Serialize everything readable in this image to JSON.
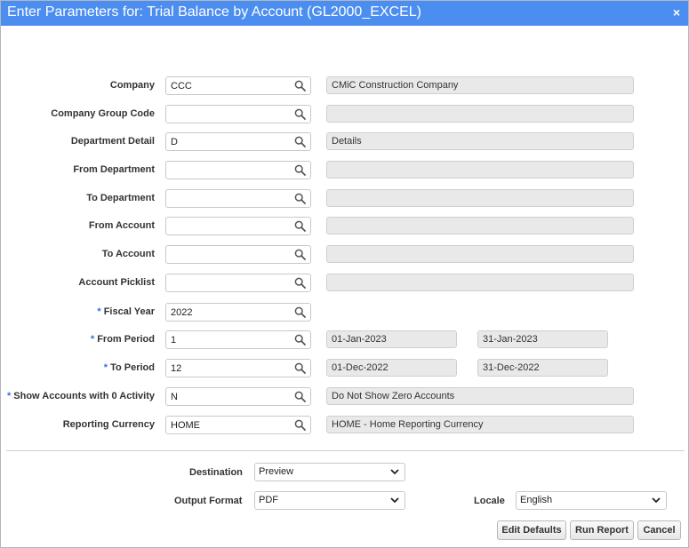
{
  "dialog": {
    "title": "Enter Parameters for: Trial Balance by Account (GL2000_EXCEL)",
    "close_glyph": "×"
  },
  "params": [
    {
      "label": "Company",
      "required": false,
      "value": "CCC",
      "desc": "CMiC Construction Company"
    },
    {
      "label": "Company Group Code",
      "required": false,
      "value": "",
      "desc": ""
    },
    {
      "label": "Department Detail",
      "required": false,
      "value": "D",
      "desc": "Details"
    },
    {
      "label": "From Department",
      "required": false,
      "value": "",
      "desc": ""
    },
    {
      "label": "To Department",
      "required": false,
      "value": "",
      "desc": ""
    },
    {
      "label": "From Account",
      "required": false,
      "value": "",
      "desc": ""
    },
    {
      "label": "To Account",
      "required": false,
      "value": "",
      "desc": ""
    },
    {
      "label": "Account Picklist",
      "required": false,
      "value": "",
      "desc": ""
    },
    {
      "label": "Fiscal Year",
      "required": true,
      "value": "2022"
    },
    {
      "label": "From Period",
      "required": true,
      "value": "1",
      "start": "01-Jan-2023",
      "end": "31-Jan-2023"
    },
    {
      "label": "To Period",
      "required": true,
      "value": "12",
      "start": "01-Dec-2022",
      "end": "31-Dec-2022"
    },
    {
      "label": "Show Accounts with 0 Activity",
      "required": true,
      "value": "N",
      "desc": "Do Not Show Zero Accounts"
    },
    {
      "label": "Reporting Currency",
      "required": false,
      "value": "HOME",
      "desc": "HOME - Home Reporting Currency"
    }
  ],
  "required_marker": "*",
  "output": {
    "destination_label": "Destination",
    "destination_value": "Preview",
    "format_label": "Output Format",
    "format_value": "PDF",
    "locale_label": "Locale",
    "locale_value": "English"
  },
  "buttons": {
    "edit_defaults": "Edit Defaults",
    "run_report": "Run Report",
    "cancel": "Cancel"
  },
  "colors": {
    "titlebar": "#4c8ef0",
    "required_marker": "#3a6fd8"
  },
  "icons": {
    "lookup": "magnifier-icon",
    "select": "chevron-down-icon",
    "close": "close-icon"
  }
}
